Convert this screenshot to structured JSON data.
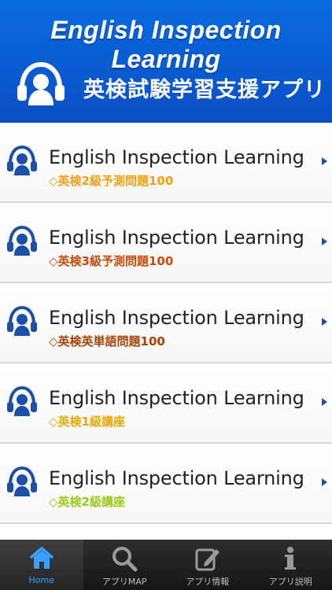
{
  "header": {
    "title": "English Inspection Learning",
    "subtitle": "英検試験学習支援アプリ",
    "logo_icon": "headphones-person-icon"
  },
  "list": {
    "items": [
      {
        "title": "English Inspection Learning",
        "subtitle": "◇英検2級予測問題100",
        "color": "#f0a010"
      },
      {
        "title": "English Inspection Learning",
        "subtitle": "◇英検3級予測問題100",
        "color": "#c94a0a"
      },
      {
        "title": "English Inspection Learning",
        "subtitle": "◇英検英単語問題100",
        "color": "#a8420a"
      },
      {
        "title": "English Inspection Learning",
        "subtitle": "◇英検1級講座",
        "color": "#e8a800"
      },
      {
        "title": "English Inspection Learning",
        "subtitle": "◇英検2級講座",
        "color": "#9cc81a"
      }
    ],
    "item_icon": "headphones-person-icon",
    "arrow_icon": "chevron-right-icon"
  },
  "tabbar": {
    "tabs": [
      {
        "label": "Home",
        "icon": "home-icon",
        "active": true
      },
      {
        "label": "アプリMAP",
        "icon": "search-icon",
        "active": false
      },
      {
        "label": "アプリ情報",
        "icon": "edit-icon",
        "active": false
      },
      {
        "label": "アプリ説明",
        "icon": "info-icon",
        "active": false
      }
    ]
  },
  "colors": {
    "header_blue": "#0a5ad0",
    "icon_blue": "#1e4fa8",
    "tab_active": "#3aa0ff"
  }
}
